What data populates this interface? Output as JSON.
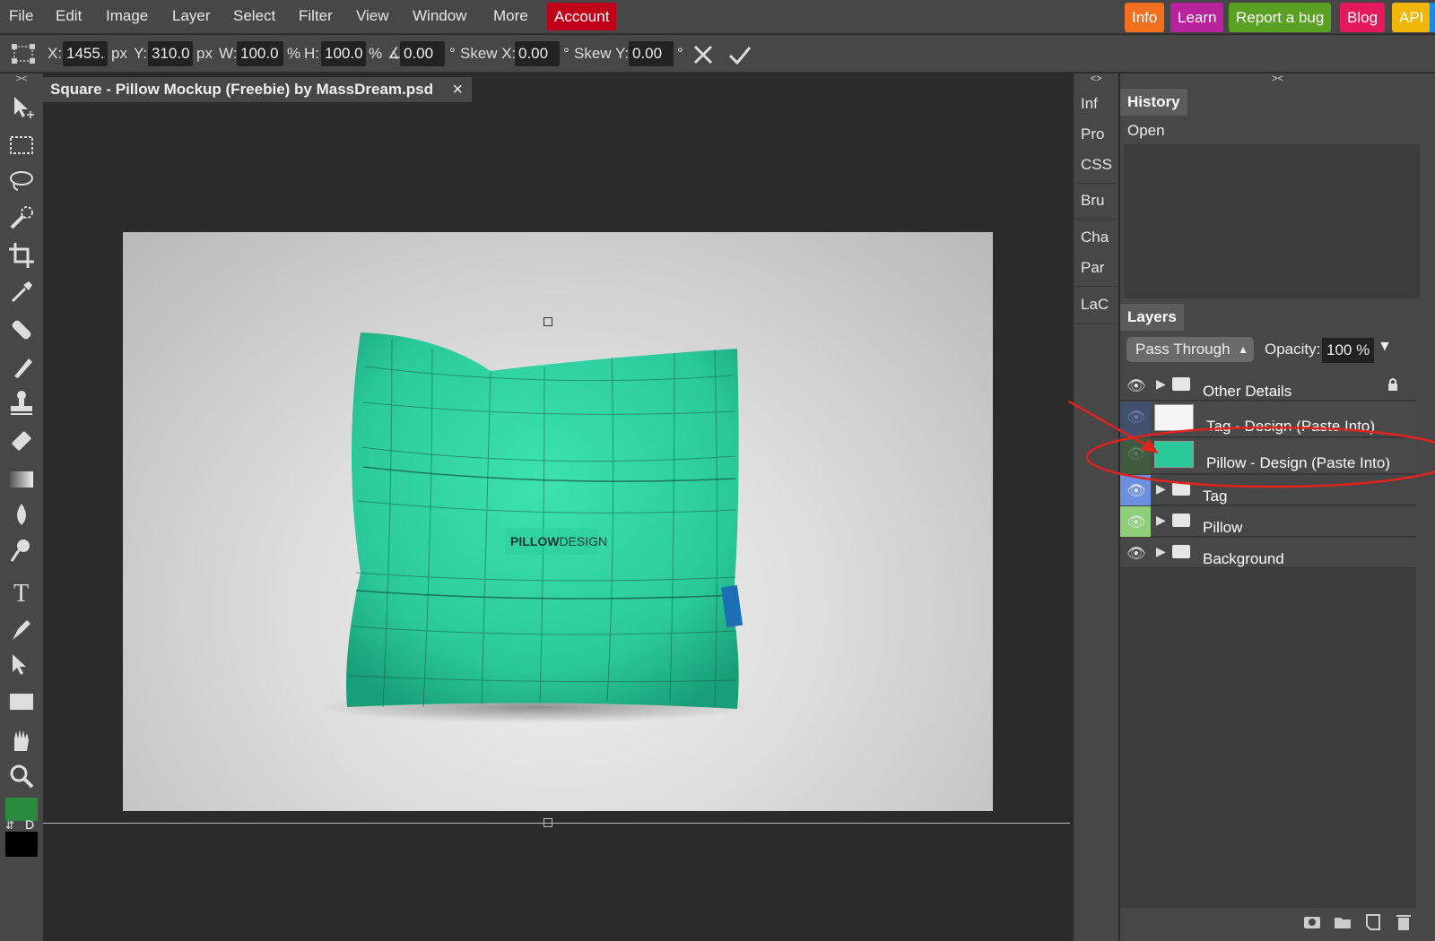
{
  "menubar": {
    "items": [
      "File",
      "Edit",
      "Image",
      "Layer",
      "Select",
      "Filter",
      "View",
      "Window",
      "More"
    ],
    "account": "Account",
    "badges": [
      {
        "label": "Info",
        "color": "#f46f1e"
      },
      {
        "label": "Learn",
        "color": "#b8229d"
      },
      {
        "label": "Report a bug",
        "color": "#5aa023"
      },
      {
        "label": "Blog",
        "color": "#e3195c"
      },
      {
        "label": "API",
        "color": "#f2b705"
      }
    ]
  },
  "transform": {
    "x_label": "X:",
    "x_value": "1455.",
    "x_unit": "px",
    "y_label": "Y:",
    "y_value": "310.0",
    "y_unit": "px",
    "w_label": "W:",
    "w_value": "100.0",
    "w_unit": "%",
    "h_label": "H:",
    "h_value": "100.0",
    "h_unit": "%",
    "angle_label": "∡:",
    "angle_value": "0.00",
    "angle_unit": "°",
    "skewx_label": "Skew X:",
    "skewx_value": "0.00",
    "skewx_unit": "°",
    "skewy_label": "Skew Y:",
    "skewy_value": "0.00",
    "skewy_unit": "°"
  },
  "document": {
    "tab_title": "Square - Pillow Mockup (Freebie) by MassDream.psd",
    "close": "×",
    "pillow_text_bold": "PILLOW",
    "pillow_text_light": "DESIGN"
  },
  "side_collapse": {
    "left": "><",
    "mid": "<>",
    "right": "><"
  },
  "midbar": [
    "Inf",
    "Pro",
    "CSS",
    "Bru",
    "Cha",
    "Par",
    "LaC"
  ],
  "history": {
    "title": "History",
    "items": [
      "Open"
    ]
  },
  "layers": {
    "title": "Layers",
    "blend_mode": "Pass Through",
    "opacity_label": "Opacity:",
    "opacity_value": "100 %",
    "rows": [
      {
        "name": "Other Details",
        "type": "folder",
        "locked": true
      },
      {
        "name": "Tag - Design (Paste Into)",
        "type": "smart"
      },
      {
        "name": "Pillow - Design (Paste Into)",
        "type": "smart"
      },
      {
        "name": "Tag",
        "type": "folder"
      },
      {
        "name": "Pillow",
        "type": "folder"
      },
      {
        "name": "Background",
        "type": "folder"
      }
    ]
  },
  "colors": {
    "foreground": "#2a8a3e",
    "background": "#000000",
    "pillow": "#2bc99a",
    "annotation": "#e0231c"
  },
  "swatch_labels": {
    "swap": "⇵",
    "default": "D"
  }
}
